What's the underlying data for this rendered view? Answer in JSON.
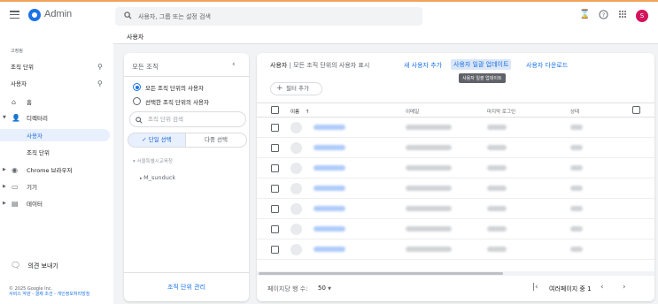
{
  "app": {
    "title": "Admin"
  },
  "header": {
    "search_placeholder": "사용자, 그룹 또는 설정 검색",
    "avatar_letter": "S"
  },
  "breadcrumb": {
    "current": "사용자"
  },
  "nav": {
    "section": "고정됨",
    "pinned": [
      "조직 단위",
      "사용자"
    ],
    "items": [
      {
        "label": "홈",
        "icon": "home-icon"
      },
      {
        "label": "디렉터리",
        "icon": "person-icon"
      },
      {
        "label": "사용자",
        "active": true
      },
      {
        "label": "조직 단위"
      },
      {
        "label": "Chrome 브라우저",
        "icon": "chrome-icon"
      },
      {
        "label": "기기",
        "icon": "devices-icon"
      },
      {
        "label": "데이터",
        "icon": "data-icon"
      }
    ],
    "feedback": "의견 보내기",
    "footer_copyright": "© 2025 Google Inc.",
    "footer_links": "서비스 약관 - 결제 조건 - 개인정보처리방침"
  },
  "org_panel": {
    "title": "모든 조직",
    "radio_all": "모든 조직 단위의 사용자",
    "radio_selected": "선택한 조직 단위의 사용자",
    "search_placeholder": "조직 단위 검색",
    "seg_single": "단일 선택",
    "seg_multi": "다중 선택",
    "tree_root": "서울특별시교육청",
    "tree_child": "M_sunduck",
    "manage": "조직 단위 관리"
  },
  "users_panel": {
    "title": "사용자",
    "subtitle": "모든 조직 단위의 사용자 표시",
    "add_user": "새 사용자 추가",
    "bulk_update": "사용자 일괄 업데이트",
    "download": "사용자 다운로드",
    "tooltip": "사용자 일괄 업데이트",
    "add_filter": "필터 추가",
    "columns": {
      "name": "이름",
      "email": "이메일",
      "last_login": "마지막 로그인",
      "status": "상태"
    },
    "row_count": 7,
    "rows_per_page_label": "페이지당 행 수:",
    "rows_per_page_value": "50",
    "page_info": "여러페이지 중 1"
  }
}
